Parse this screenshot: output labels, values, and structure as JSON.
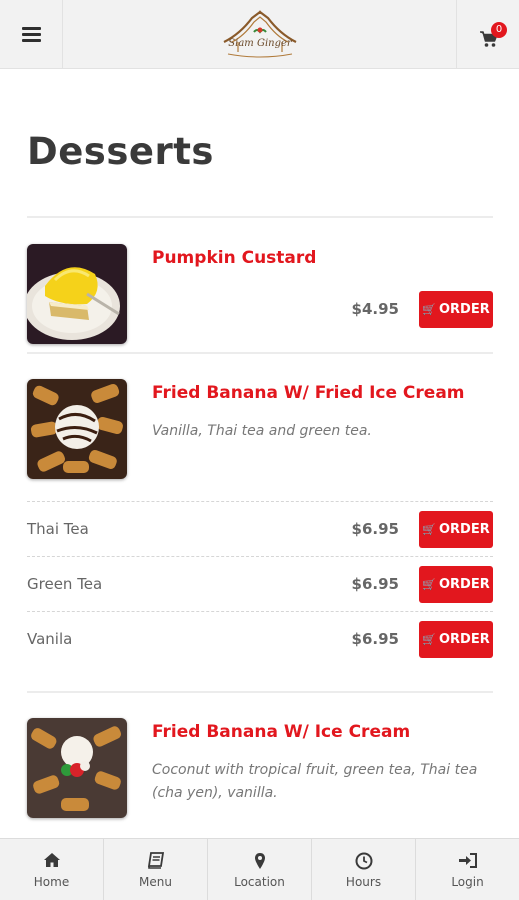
{
  "header": {
    "logo_text": "Siam Ginger",
    "cart_count": "0",
    "icons": [
      "hamburger-menu-icon",
      "cart-icon"
    ]
  },
  "page": {
    "title": "Desserts"
  },
  "items": [
    {
      "name": "Pumpkin Custard",
      "description": "",
      "price": "$4.95",
      "order_label": "ORDER",
      "image": "pumpkin-custard-photo"
    },
    {
      "name": "Fried Banana W/ Fried Ice Cream",
      "description": "Vanilla, Thai tea and green tea.",
      "image": "fried-banana-fried-ice-cream-photo",
      "variants": [
        {
          "name": "Thai Tea",
          "price": "$6.95",
          "order_label": "ORDER"
        },
        {
          "name": "Green Tea",
          "price": "$6.95",
          "order_label": "ORDER"
        },
        {
          "name": "Vanila",
          "price": "$6.95",
          "order_label": "ORDER"
        }
      ]
    },
    {
      "name": "Fried Banana W/ Ice Cream",
      "description_line1": "Coconut with tropical fruit, green tea, Thai tea",
      "description_line2": "(cha yen), vanilla.",
      "image": "fried-banana-ice-cream-photo"
    }
  ],
  "bottom_nav": [
    {
      "label": "Home",
      "icon": "home-icon"
    },
    {
      "label": "Menu",
      "icon": "book-icon"
    },
    {
      "label": "Location",
      "icon": "map-pin-icon"
    },
    {
      "label": "Hours",
      "icon": "clock-icon"
    },
    {
      "label": "Login",
      "icon": "sign-in-icon"
    }
  ],
  "colors": {
    "accent": "#e2171e",
    "bar_bg": "#f2f2f2",
    "title": "#3a3a3a"
  }
}
